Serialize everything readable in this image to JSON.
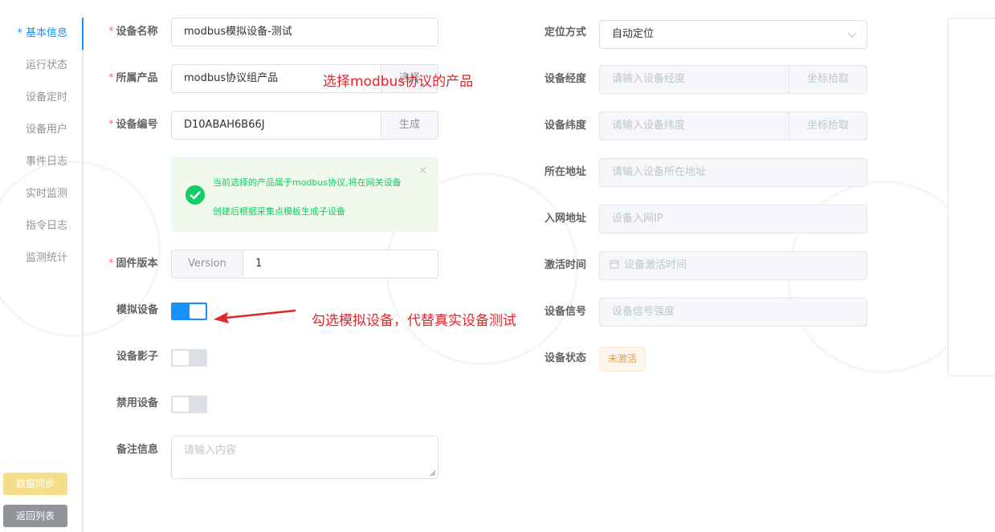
{
  "tabs": [
    {
      "label": "* 基本信息",
      "active": true
    },
    {
      "label": "运行状态"
    },
    {
      "label": "设备定时"
    },
    {
      "label": "设备用户"
    },
    {
      "label": "事件日志"
    },
    {
      "label": "实时监测"
    },
    {
      "label": "指令日志"
    },
    {
      "label": "监测统计"
    }
  ],
  "buttons": {
    "sync": "数据同步",
    "back": "返回列表"
  },
  "form": {
    "device_name": {
      "label": "设备名称",
      "value": "modbus模拟设备-测试"
    },
    "product": {
      "label": "所属产品",
      "value": "modbus协议组产品",
      "append": "选择"
    },
    "device_no": {
      "label": "设备编号",
      "value": "D10ABAH6B66J",
      "append": "生成"
    },
    "alert": {
      "line1": "当前选择的产品属于modbus协议,将在网关设备",
      "line2": "创建后根据采集点模板生成子设备",
      "close": "×"
    },
    "firmware": {
      "label": "固件版本",
      "prepend": "Version",
      "value": "1"
    },
    "simulate": {
      "label": "模拟设备",
      "on": true
    },
    "shadow": {
      "label": "设备影子",
      "on": false
    },
    "disable": {
      "label": "禁用设备",
      "on": false
    },
    "remark": {
      "label": "备注信息",
      "placeholder": "请输入内容"
    },
    "location_mode": {
      "label": "定位方式",
      "value": "自动定位"
    },
    "longitude": {
      "label": "设备经度",
      "placeholder": "请输入设备经度",
      "append": "坐标拾取"
    },
    "latitude": {
      "label": "设备纬度",
      "placeholder": "请输入设备纬度",
      "append": "坐标拾取"
    },
    "address": {
      "label": "所在地址",
      "placeholder": "请输入设备所在地址"
    },
    "network_address": {
      "label": "入网地址",
      "placeholder": "设备入网IP"
    },
    "activation_time": {
      "label": "激活时间",
      "placeholder": "设备激活时间"
    },
    "signal": {
      "label": "设备信号",
      "placeholder": "设备信号强度"
    },
    "status": {
      "label": "设备状态",
      "value": "未激活"
    }
  },
  "annotations": {
    "product_note": "选择modbus协议的产品",
    "simulate_note": "勾选模拟设备，代替真实设备测试"
  },
  "colors": {
    "primary": "#1890ff",
    "success": "#13ce66",
    "danger": "#e0262c",
    "warning": "#e6a23c"
  }
}
